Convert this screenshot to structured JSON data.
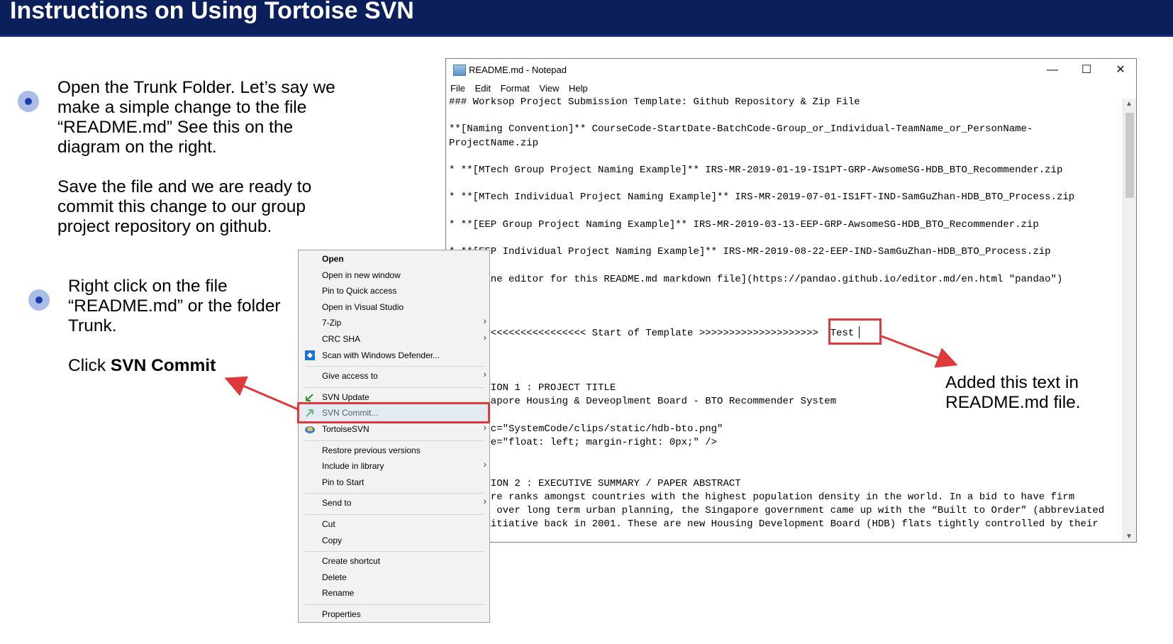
{
  "header": {
    "title": "Instructions on Using Tortoise SVN"
  },
  "instructions": {
    "step1_p1": "Open the Trunk Folder. Let’s say we\nmake a simple change to the file\n“README.md” See this on the\ndiagram on the right.",
    "step1_p2": "Save the file and we are ready to\ncommit this change to our group\nproject repository on github.",
    "step2_p1": "Right click on the file\n“README.md” or the folder\nTrunk.",
    "step2_p2_prefix": "Click ",
    "step2_p2_bold": "SVN Commit"
  },
  "notepad": {
    "title": "README.md - Notepad",
    "controls": {
      "minimize": "—",
      "maximize": "☐",
      "close": "✕"
    },
    "menu": [
      "File",
      "Edit",
      "Format",
      "View",
      "Help"
    ],
    "lines": [
      "### Worksop Project Submission Template: Github Repository & Zip File",
      "",
      "**[Naming Convention]** CourseCode-StartDate-BatchCode-Group_or_Individual-TeamName_or_PersonName-",
      "ProjectName.zip",
      "",
      "* **[MTech Group Project Naming Example]** IRS-MR-2019-01-19-IS1PT-GRP-AwsomeSG-HDB_BTO_Recommender.zip",
      "",
      "* **[MTech Individual Project Naming Example]** IRS-MR-2019-07-01-IS1FT-IND-SamGuZhan-HDB_BTO_Process.zip",
      "",
      "* **[EEP Group Project Naming Example]** IRS-MR-2019-03-13-EEP-GRP-AwsomeSG-HDB_BTO_Recommender.zip",
      "",
      "* **[EEP Individual Project Naming Example]** IRS-MR-2019-08-22-EEP-IND-SamGuZhan-HDB_BTO_Process.zip",
      "",
      "* [Online editor for this README.md markdown file](https://pandao.github.io/editor.md/en.html \"pandao\")",
      "",
      "---",
      "",
      "## <<<<<<<<<<<<<<<<<<<< Start of Template >>>>>>>>>>>>>>>>>>>>  Test",
      "",
      "---",
      "",
      "## SECTION 1 : PROJECT TITLE",
      "## Singapore Housing & Deveoplment Board - BTO Recommender System",
      "",
      "<img src=\"SystemCode/clips/static/hdb-bto.png\"",
      "   style=\"float: left; margin-right: 0px;\" />",
      "",
      "---",
      "## SECTION 2 : EXECUTIVE SUMMARY / PAPER ABSTRACT",
      "Singapore ranks amongst countries with the highest population density in the world. In a bid to have firm",
      "control over long term urban planning, the Singapore government came up with the “Built to Order” (abbreviated",
      "BTO) initiative back in 2001. These are new Housing Development Board (HDB) flats tightly controlled by their"
    ]
  },
  "context_menu": {
    "items": [
      {
        "label": "Open",
        "bold": true,
        "icon": "",
        "arrow": false
      },
      {
        "label": "Open in new window",
        "icon": "",
        "arrow": false
      },
      {
        "label": "Pin to Quick access",
        "icon": "",
        "arrow": false
      },
      {
        "label": "Open in Visual Studio",
        "icon": "",
        "arrow": false
      },
      {
        "label": "7-Zip",
        "icon": "",
        "arrow": true
      },
      {
        "label": "CRC SHA",
        "icon": "",
        "arrow": true
      },
      {
        "label": "Scan with Windows Defender...",
        "icon": "defender-shield-icon",
        "arrow": false
      },
      {
        "sep": true
      },
      {
        "label": "Give access to",
        "icon": "",
        "arrow": true
      },
      {
        "sep": true
      },
      {
        "label": "SVN Update",
        "icon": "svn-update-icon",
        "arrow": false
      },
      {
        "label": "SVN Commit...",
        "icon": "svn-commit-icon",
        "arrow": false
      },
      {
        "label": "TortoiseSVN",
        "icon": "tortoisesvn-icon",
        "arrow": true
      },
      {
        "sep": true
      },
      {
        "label": "Restore previous versions",
        "icon": "",
        "arrow": false
      },
      {
        "label": "Include in library",
        "icon": "",
        "arrow": true
      },
      {
        "label": "Pin to Start",
        "icon": "",
        "arrow": false
      },
      {
        "sep": true
      },
      {
        "label": "Send to",
        "icon": "",
        "arrow": true
      },
      {
        "sep": true
      },
      {
        "label": "Cut",
        "icon": "",
        "arrow": false
      },
      {
        "label": "Copy",
        "icon": "",
        "arrow": false
      },
      {
        "sep": true
      },
      {
        "label": "Create shortcut",
        "icon": "",
        "arrow": false
      },
      {
        "label": "Delete",
        "icon": "",
        "arrow": false
      },
      {
        "label": "Rename",
        "icon": "",
        "arrow": false
      },
      {
        "sep": true
      },
      {
        "label": "Properties",
        "icon": "",
        "arrow": false
      }
    ]
  },
  "annotations": {
    "added_text": "Added this text in\nREADME.md file.",
    "accent_color": "#e0393b"
  }
}
